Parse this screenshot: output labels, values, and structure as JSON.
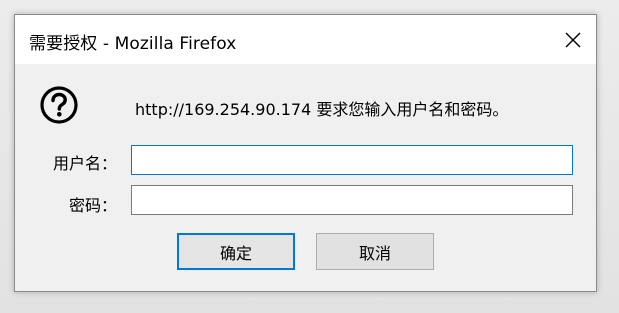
{
  "window": {
    "title": "需要授权 - Mozilla Firefox",
    "close_icon": "close-icon"
  },
  "dialog": {
    "icon": "question-icon",
    "message": "http://169.254.90.174 要求您输入用户名和密码。",
    "username_label": "用户名：",
    "password_label": "密码：",
    "username_value": "",
    "password_value": "",
    "ok_label": "确定",
    "cancel_label": "取消"
  },
  "colors": {
    "focus_accent": "#0078d7",
    "dialog_bg": "#f0f0f0",
    "titlebar_bg": "#ffffff"
  }
}
